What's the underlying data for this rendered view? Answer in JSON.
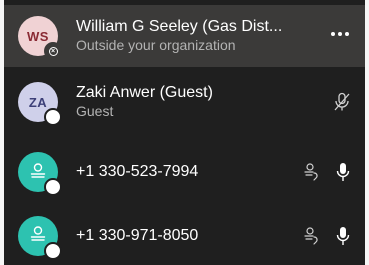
{
  "participants": [
    {
      "initials": "WS",
      "name": "William G Seeley (Gas Dist...",
      "subtitle": "Outside your organization",
      "avatar_color": "#f0d2d4",
      "status_icon": "blocked-presence-icon",
      "selected": true,
      "actions": [
        "more-options-icon"
      ]
    },
    {
      "initials": "ZA",
      "name": "Zaki Anwer (Guest)",
      "subtitle": "Guest",
      "avatar_color": "#cfd0ea",
      "status_icon": "presence-icon",
      "actions": [
        "mic-muted-icon"
      ]
    },
    {
      "initials": "",
      "name": "+1 330-523-7994",
      "subtitle": "",
      "avatar_color": "#2dc2b0",
      "avatar_icon": "phone-person-icon",
      "status_icon": "presence-icon",
      "actions": [
        "phone-dialin-icon",
        "mic-icon"
      ]
    },
    {
      "initials": "",
      "name": "+1 330-971-8050",
      "subtitle": "",
      "avatar_color": "#2dc2b0",
      "avatar_icon": "phone-person-icon",
      "status_icon": "presence-icon",
      "actions": [
        "phone-dialin-icon",
        "mic-icon"
      ]
    }
  ]
}
